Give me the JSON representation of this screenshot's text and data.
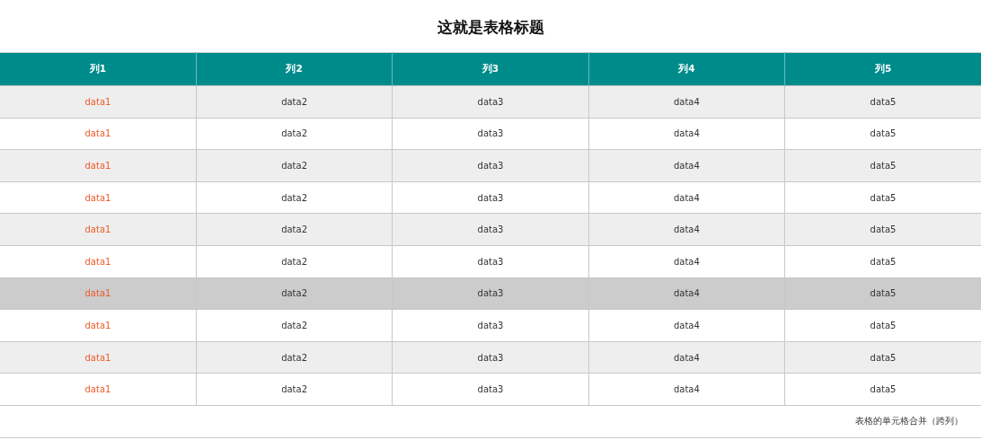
{
  "title": "这就是表格标题",
  "table": {
    "columns": [
      "列1",
      "列2",
      "列3",
      "列4",
      "列5"
    ],
    "rows": [
      {
        "cells": [
          "data1",
          "data2",
          "data3",
          "data4",
          "data5"
        ],
        "selected": false
      },
      {
        "cells": [
          "data1",
          "data2",
          "data3",
          "data4",
          "data5"
        ],
        "selected": false
      },
      {
        "cells": [
          "data1",
          "data2",
          "data3",
          "data4",
          "data5"
        ],
        "selected": false
      },
      {
        "cells": [
          "data1",
          "data2",
          "data3",
          "data4",
          "data5"
        ],
        "selected": false
      },
      {
        "cells": [
          "data1",
          "data2",
          "data3",
          "data4",
          "data5"
        ],
        "selected": false
      },
      {
        "cells": [
          "data1",
          "data2",
          "data3",
          "data4",
          "data5"
        ],
        "selected": false
      },
      {
        "cells": [
          "data1",
          "data2",
          "data3",
          "data4",
          "data5"
        ],
        "selected": true
      },
      {
        "cells": [
          "data1",
          "data2",
          "data3",
          "data4",
          "data5"
        ],
        "selected": false
      },
      {
        "cells": [
          "data1",
          "data2",
          "data3",
          "data4",
          "data5"
        ],
        "selected": false
      },
      {
        "cells": [
          "data1",
          "data2",
          "data3",
          "data4",
          "data5"
        ],
        "selected": false
      }
    ],
    "footer": "表格的单元格合并（跨列）"
  }
}
